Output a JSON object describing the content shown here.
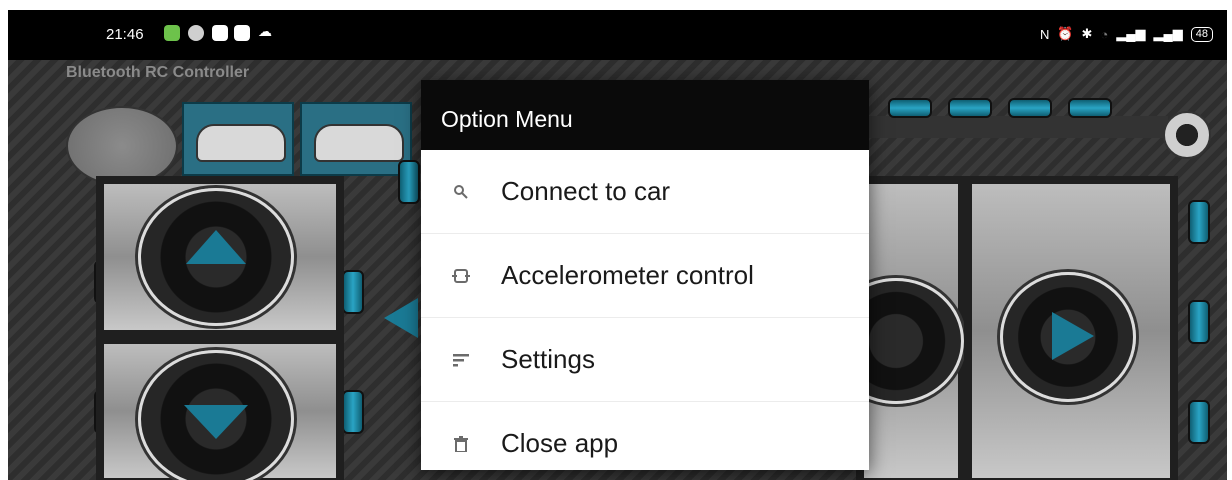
{
  "status_bar": {
    "time": "21:46",
    "battery": "48"
  },
  "app": {
    "title": "Bluetooth RC Controller"
  },
  "menu": {
    "title": "Option Menu",
    "items": [
      {
        "label": "Connect to car",
        "icon": "search-icon"
      },
      {
        "label": "Accelerometer control",
        "icon": "rotate-phone-icon"
      },
      {
        "label": "Settings",
        "icon": "settings-lines-icon"
      },
      {
        "label": "Close app",
        "icon": "trash-icon"
      }
    ]
  },
  "colors": {
    "accent_tube": "#2aa4c4",
    "menu_header": "#0a0a0a",
    "car_button": "#2a6f84"
  }
}
